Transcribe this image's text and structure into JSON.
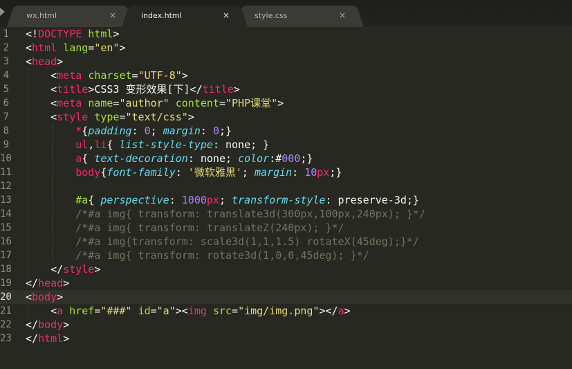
{
  "tabs": [
    {
      "label": "wx.html",
      "close": "×",
      "active": false
    },
    {
      "label": "index.html",
      "close": "×",
      "active": true
    },
    {
      "label": "style.css",
      "close": "×",
      "active": false
    }
  ],
  "current_line": "20",
  "lines": [
    {
      "n": "1",
      "tokens": [
        [
          "plain",
          "<!"
        ],
        [
          "tag",
          "DOCTYPE"
        ],
        [
          "plain",
          " "
        ],
        [
          "attr",
          "html"
        ],
        [
          "plain",
          ">"
        ]
      ]
    },
    {
      "n": "2",
      "tokens": [
        [
          "plain",
          "<"
        ],
        [
          "tag",
          "html"
        ],
        [
          "plain",
          " "
        ],
        [
          "attr",
          "lang"
        ],
        [
          "plain",
          "="
        ],
        [
          "str",
          "\"en\""
        ],
        [
          "plain",
          ">"
        ]
      ]
    },
    {
      "n": "3",
      "tokens": [
        [
          "plain",
          "<"
        ],
        [
          "tag",
          "head"
        ],
        [
          "plain",
          ">"
        ]
      ]
    },
    {
      "n": "4",
      "tokens": [
        [
          "plain",
          "    <"
        ],
        [
          "tag",
          "meta"
        ],
        [
          "plain",
          " "
        ],
        [
          "attr",
          "charset"
        ],
        [
          "plain",
          "="
        ],
        [
          "str",
          "\"UTF-8\""
        ],
        [
          "plain",
          ">"
        ]
      ]
    },
    {
      "n": "5",
      "tokens": [
        [
          "plain",
          "    <"
        ],
        [
          "tag",
          "title"
        ],
        [
          "plain",
          ">CSS3 变形效果[下]</"
        ],
        [
          "tag",
          "title"
        ],
        [
          "plain",
          ">"
        ]
      ]
    },
    {
      "n": "6",
      "tokens": [
        [
          "plain",
          "    <"
        ],
        [
          "tag",
          "meta"
        ],
        [
          "plain",
          " "
        ],
        [
          "attr",
          "name"
        ],
        [
          "plain",
          "="
        ],
        [
          "str",
          "\"author\""
        ],
        [
          "plain",
          " "
        ],
        [
          "attr",
          "content"
        ],
        [
          "plain",
          "="
        ],
        [
          "str",
          "\"PHP课堂\""
        ],
        [
          "plain",
          ">"
        ]
      ]
    },
    {
      "n": "7",
      "tokens": [
        [
          "plain",
          "    <"
        ],
        [
          "tag",
          "style"
        ],
        [
          "plain",
          " "
        ],
        [
          "attr",
          "type"
        ],
        [
          "plain",
          "="
        ],
        [
          "str",
          "\"text/css\""
        ],
        [
          "plain",
          ">"
        ]
      ]
    },
    {
      "n": "8",
      "tokens": [
        [
          "plain",
          "        "
        ],
        [
          "tag",
          "*"
        ],
        [
          "plain",
          "{"
        ],
        [
          "prop",
          "padding"
        ],
        [
          "plain",
          ": "
        ],
        [
          "num",
          "0"
        ],
        [
          "plain",
          "; "
        ],
        [
          "prop",
          "margin"
        ],
        [
          "plain",
          ": "
        ],
        [
          "num",
          "0"
        ],
        [
          "plain",
          ";}"
        ]
      ]
    },
    {
      "n": "9",
      "tokens": [
        [
          "plain",
          "        "
        ],
        [
          "tag",
          "ul"
        ],
        [
          "plain",
          ","
        ],
        [
          "tag",
          "li"
        ],
        [
          "plain",
          "{ "
        ],
        [
          "prop",
          "list-style-type"
        ],
        [
          "plain",
          ": none; }"
        ]
      ]
    },
    {
      "n": "10",
      "tokens": [
        [
          "plain",
          "        "
        ],
        [
          "tag",
          "a"
        ],
        [
          "plain",
          "{ "
        ],
        [
          "prop",
          "text-decoration"
        ],
        [
          "plain",
          ": none; "
        ],
        [
          "prop",
          "color"
        ],
        [
          "plain",
          ":#"
        ],
        [
          "num",
          "000"
        ],
        [
          "plain",
          ";}"
        ]
      ]
    },
    {
      "n": "11",
      "tokens": [
        [
          "plain",
          "        "
        ],
        [
          "tag",
          "body"
        ],
        [
          "plain",
          "{"
        ],
        [
          "prop",
          "font-family"
        ],
        [
          "plain",
          ": "
        ],
        [
          "str",
          "'微软雅黑'"
        ],
        [
          "plain",
          "; "
        ],
        [
          "prop",
          "margin"
        ],
        [
          "plain",
          ": "
        ],
        [
          "num",
          "10"
        ],
        [
          "tag",
          "px"
        ],
        [
          "plain",
          ";}"
        ]
      ]
    },
    {
      "n": "12",
      "tokens": []
    },
    {
      "n": "13",
      "tokens": [
        [
          "plain",
          "        "
        ],
        [
          "sel",
          "#a"
        ],
        [
          "plain",
          "{ "
        ],
        [
          "prop",
          "perspective"
        ],
        [
          "plain",
          ": "
        ],
        [
          "num",
          "1000"
        ],
        [
          "tag",
          "px"
        ],
        [
          "plain",
          "; "
        ],
        [
          "prop",
          "transform-style"
        ],
        [
          "plain",
          ": preserve-3d;}"
        ]
      ]
    },
    {
      "n": "14",
      "tokens": [
        [
          "cmt",
          "        /*#a img{ transform: translate3d(300px,100px,240px); }*/"
        ]
      ]
    },
    {
      "n": "15",
      "tokens": [
        [
          "cmt",
          "        /*#a img{ transform: translateZ(240px); }*/"
        ]
      ]
    },
    {
      "n": "16",
      "tokens": [
        [
          "cmt",
          "        /*#a img{transform: scale3d(1,1,1.5) rotateX(45deg);}*/"
        ]
      ]
    },
    {
      "n": "17",
      "tokens": [
        [
          "cmt",
          "        /*#a img{ transform: rotate3d(1,0,0,45deg); }*/"
        ]
      ]
    },
    {
      "n": "18",
      "tokens": [
        [
          "plain",
          "    </"
        ],
        [
          "tag",
          "style"
        ],
        [
          "plain",
          ">"
        ]
      ]
    },
    {
      "n": "19",
      "tokens": [
        [
          "plain",
          "</"
        ],
        [
          "tag",
          "head"
        ],
        [
          "plain",
          ">"
        ]
      ]
    },
    {
      "n": "20",
      "tokens": [
        [
          "plain",
          "<"
        ],
        [
          "tag",
          "body"
        ],
        [
          "plain",
          ">"
        ]
      ]
    },
    {
      "n": "21",
      "tokens": [
        [
          "plain",
          "    <"
        ],
        [
          "tag",
          "a"
        ],
        [
          "plain",
          " "
        ],
        [
          "attr",
          "href"
        ],
        [
          "plain",
          "="
        ],
        [
          "str",
          "\"###\""
        ],
        [
          "plain",
          " "
        ],
        [
          "attr",
          "id"
        ],
        [
          "plain",
          "="
        ],
        [
          "str",
          "\"a\""
        ],
        [
          "plain",
          "><"
        ],
        [
          "tag",
          "img"
        ],
        [
          "plain",
          " "
        ],
        [
          "attr",
          "src"
        ],
        [
          "plain",
          "="
        ],
        [
          "str",
          "\"img/img.png\""
        ],
        [
          "plain",
          "></"
        ],
        [
          "tag",
          "a"
        ],
        [
          "plain",
          ">"
        ]
      ]
    },
    {
      "n": "22",
      "tokens": [
        [
          "plain",
          "</"
        ],
        [
          "tag",
          "body"
        ],
        [
          "plain",
          ">"
        ]
      ]
    },
    {
      "n": "23",
      "tokens": [
        [
          "plain",
          "</"
        ],
        [
          "tag",
          "html"
        ],
        [
          "plain",
          ">"
        ]
      ]
    }
  ],
  "colors": {
    "background": "#272822",
    "tag": "#f92672",
    "attribute": "#a6e22e",
    "string": "#e6db74",
    "property": "#66d9ef",
    "number": "#ae81ff",
    "comment": "#75715e"
  }
}
